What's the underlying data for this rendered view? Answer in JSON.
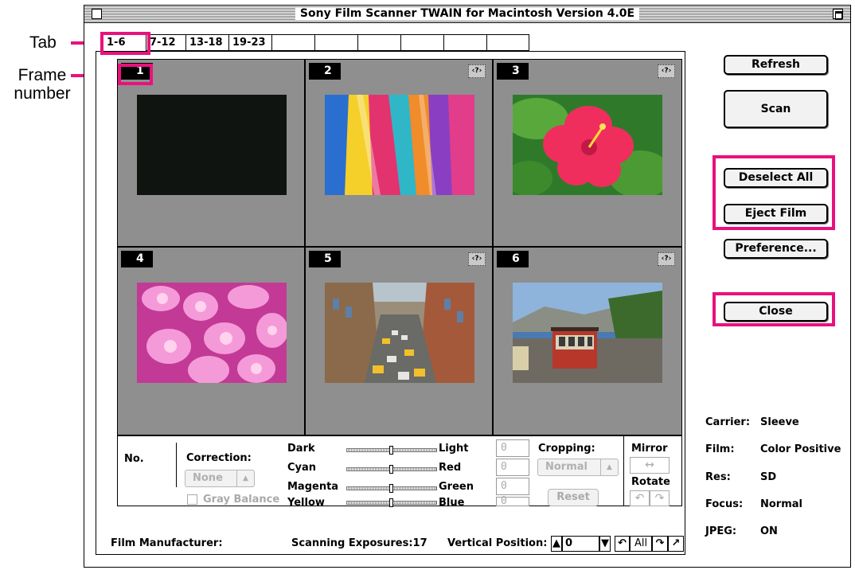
{
  "window": {
    "title": "Sony Film Scanner TWAIN for Macintosh Version 4.0E"
  },
  "annotations": {
    "tab_label": "Tab",
    "frame_number_label": "Frame number"
  },
  "tabs": [
    "1-6",
    "7-12",
    "13-18",
    "19-23",
    "",
    "",
    "",
    "",
    "",
    ""
  ],
  "frames": [
    {
      "number": "1",
      "has_help": false,
      "image": "dark-empty-frame"
    },
    {
      "number": "2",
      "has_help": true,
      "image": "colorful-fabric-photo"
    },
    {
      "number": "3",
      "has_help": true,
      "image": "red-hibiscus-photo"
    },
    {
      "number": "4",
      "has_help": false,
      "image": "pink-orchids-photo"
    },
    {
      "number": "5",
      "has_help": true,
      "image": "city-street-photo"
    },
    {
      "number": "6",
      "has_help": true,
      "image": "cable-car-photo"
    }
  ],
  "help_glyph": "‹?›",
  "controls": {
    "no_label": "No.",
    "correction_label": "Correction:",
    "correction_value": "None",
    "gray_balance_label": "Gray Balance",
    "sliders": [
      {
        "left": "Dark",
        "right": "Light",
        "value": "0",
        "position": 0.5
      },
      {
        "left": "Cyan",
        "right": "Red",
        "value": "0",
        "position": 0.5
      },
      {
        "left": "Magenta",
        "right": "Green",
        "value": "0",
        "position": 0.5
      },
      {
        "left": "Yellow",
        "right": "Blue",
        "value": "0",
        "position": 0.5
      }
    ],
    "cropping_label": "Cropping:",
    "cropping_value": "Normal",
    "reset_label": "Reset",
    "mirror_label": "Mirror",
    "rotate_label": "Rotate"
  },
  "status": {
    "film_manufacturer_label": "Film Manufacturer:",
    "scanning_exposures": "Scanning Exposures:17",
    "vertical_position_label": "Vertical Position:",
    "vertical_position_value": "0",
    "all_label": "All"
  },
  "buttons": {
    "refresh": "Refresh",
    "scan": "Scan",
    "deselect_all": "Deselect All",
    "eject_film": "Eject Film",
    "preference": "Preference...",
    "close": "Close"
  },
  "info": [
    {
      "label": "Carrier:",
      "value": "Sleeve"
    },
    {
      "label": "Film:",
      "value": "Color Positive"
    },
    {
      "label": "Res:",
      "value": "SD"
    },
    {
      "label": "Focus:",
      "value": "Normal"
    },
    {
      "label": "JPEG:",
      "value": "ON"
    }
  ],
  "colors": {
    "highlight": "#e8127c",
    "frame_gray": "#8f8f8f"
  }
}
